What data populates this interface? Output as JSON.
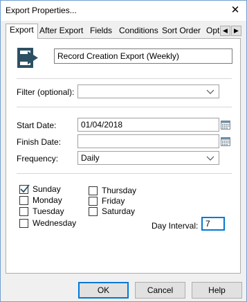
{
  "window": {
    "title": "Export Properties...",
    "close_glyph": "✕"
  },
  "tabs": [
    "Export",
    "After Export",
    "Fields",
    "Conditions",
    "Sort Order",
    "Opti"
  ],
  "tab_scroll": {
    "left": "◀",
    "right": "▶"
  },
  "export_name": "Record Creation Export (Weekly)",
  "filter": {
    "label": "Filter (optional):",
    "value": ""
  },
  "start_date": {
    "label": "Start Date:",
    "value": "01/04/2018"
  },
  "finish_date": {
    "label": "Finish Date:",
    "value": ""
  },
  "frequency": {
    "label": "Frequency:",
    "value": "Daily"
  },
  "days": [
    {
      "label": "Sunday",
      "checked": true
    },
    {
      "label": "Monday",
      "checked": false
    },
    {
      "label": "Tuesday",
      "checked": false
    },
    {
      "label": "Wednesday",
      "checked": false
    },
    {
      "label": "Thursday",
      "checked": false
    },
    {
      "label": "Friday",
      "checked": false
    },
    {
      "label": "Saturday",
      "checked": false
    }
  ],
  "day_interval": {
    "label": "Day Interval:",
    "value": "7"
  },
  "buttons": {
    "ok": "OK",
    "cancel": "Cancel",
    "help": "Help"
  },
  "colors": {
    "accent": "#0078d7",
    "icon": "#2d4f63"
  }
}
